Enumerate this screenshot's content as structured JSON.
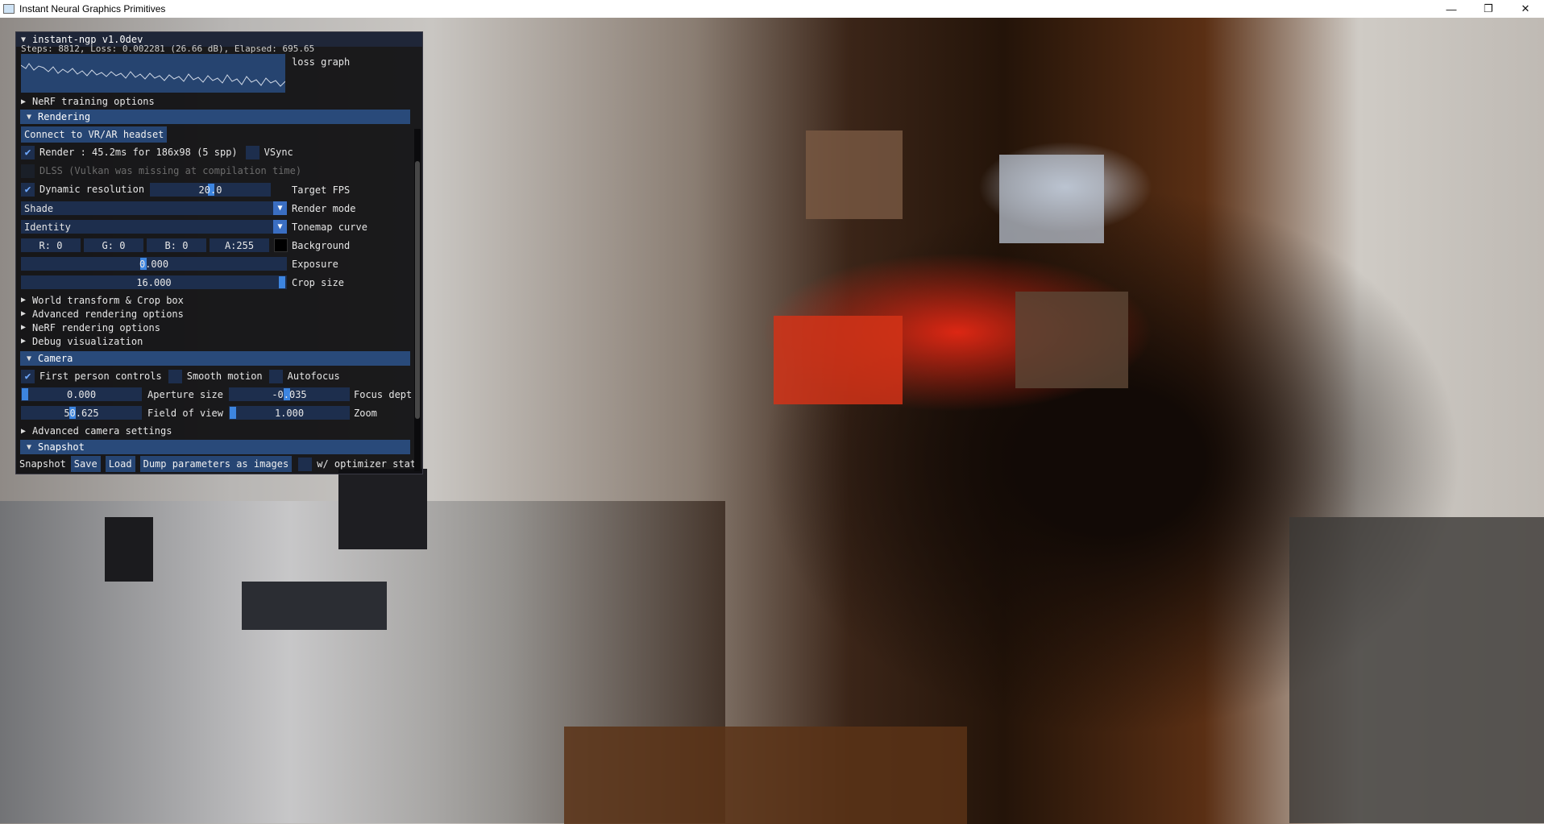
{
  "window": {
    "title": "Instant Neural Graphics Primitives",
    "controls": {
      "minimize": "—",
      "maximize": "❐",
      "close": "✕"
    }
  },
  "panel": {
    "title": "instant-ngp v1.0dev",
    "status_line": "Steps: 8812, Loss: 0.002281 (26.66 dB), Elapsed: 695.65",
    "loss_graph_label": "loss graph",
    "nerf_training_options": "NeRF training options",
    "rendering": {
      "header": "Rendering",
      "connect_vr": "Connect to VR/AR headset",
      "render_label": "Render : 45.2ms for 186x98 (5 spp)",
      "render_checked": true,
      "vsync_label": "VSync",
      "dlss_label": "DLSS (Vulkan was missing at compilation time)",
      "dynamic_res_label": "Dynamic resolution",
      "dynamic_res_checked": true,
      "target_fps_value": "20.0",
      "target_fps_label": "Target FPS",
      "render_mode_value": "Shade",
      "render_mode_label": "Render mode",
      "tonemap_value": "Identity",
      "tonemap_label": "Tonemap curve",
      "bg_r": "R:  0",
      "bg_g": "G:  0",
      "bg_b": "B:  0",
      "bg_a": "A:255",
      "background_label": "Background",
      "background_color": "#000000",
      "exposure_value": "0.000",
      "exposure_label": "Exposure",
      "crop_value": "16.000",
      "crop_label": "Crop size",
      "world_transform": "World transform & Crop box",
      "advanced_rendering": "Advanced rendering options",
      "nerf_rendering": "NeRF rendering options",
      "debug_vis": "Debug visualization"
    },
    "camera": {
      "header": "Camera",
      "first_person_label": "First person controls",
      "first_person_checked": true,
      "smooth_motion_label": "Smooth motion",
      "autofocus_label": "Autofocus",
      "aperture_value": "0.000",
      "aperture_label": "Aperture size",
      "focus_value": "-0.035",
      "focus_label": "Focus dept",
      "fov_value": "50.625",
      "fov_label": "Field of view",
      "zoom_value": "1.000",
      "zoom_label": "Zoom",
      "advanced_camera": "Advanced camera settings"
    },
    "snapshot": {
      "header": "Snapshot",
      "label": "Snapshot",
      "save": "Save",
      "load": "Load",
      "dump": "Dump parameters as images",
      "optimizer_label": "w/ optimizer stat"
    }
  },
  "colors": {
    "panel_bg": "#0f0f11",
    "header_bg": "#294a7a",
    "frame_bg": "#1d2e4d",
    "accent": "#3d85e0",
    "nose": "#e22a14"
  }
}
